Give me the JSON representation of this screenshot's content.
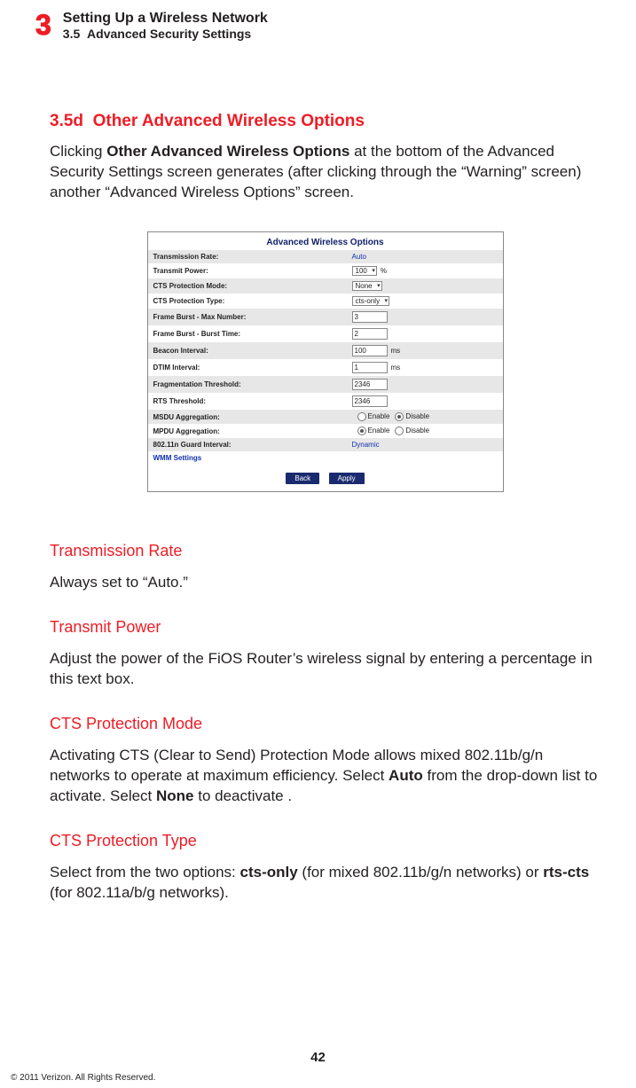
{
  "header": {
    "chapter_number": "3",
    "chapter_title": "Setting Up a Wireless Network",
    "section_number": "3.5",
    "section_title": "Advanced Security Settings"
  },
  "section_heading": {
    "number": "3.5d",
    "title": "Other Advanced Wireless Options"
  },
  "intro": {
    "pre": "Clicking ",
    "bold": "Other Advanced Wireless Options",
    "post": " at the bottom of the Advanced Security Settings screen generates (after clicking through the “Warning” screen) another “Advanced Wireless Options” screen."
  },
  "screenshot": {
    "panel_title": "Advanced Wireless Options",
    "rows": [
      {
        "label": "Transmission Rate:",
        "value": "Auto",
        "kind": "text"
      },
      {
        "label": "Transmit Power:",
        "value": "100",
        "unit": "%",
        "kind": "select"
      },
      {
        "label": "CTS Protection Mode:",
        "value": "None",
        "kind": "select"
      },
      {
        "label": "CTS Protection Type:",
        "value": "cts-only",
        "kind": "select"
      },
      {
        "label": "Frame Burst - Max Number:",
        "value": "3",
        "kind": "input"
      },
      {
        "label": "Frame Burst - Burst Time:",
        "value": "2",
        "kind": "input"
      },
      {
        "label": "Beacon Interval:",
        "value": "100",
        "unit": "ms",
        "kind": "input"
      },
      {
        "label": "DTIM Interval:",
        "value": "1",
        "unit": "ms",
        "kind": "input"
      },
      {
        "label": "Fragmentation Threshold:",
        "value": "2346",
        "kind": "input"
      },
      {
        "label": "RTS Threshold:",
        "value": "2346",
        "kind": "input"
      },
      {
        "label": "MSDU Aggregation:",
        "enable": "Enable",
        "disable": "Disable",
        "selected": "disable",
        "kind": "radio"
      },
      {
        "label": "MPDU Aggregation:",
        "enable": "Enable",
        "disable": "Disable",
        "selected": "enable",
        "kind": "radio"
      },
      {
        "label": "802.11n Guard Interval:",
        "value": "Dynamic",
        "kind": "text"
      }
    ],
    "link_row": "WMM Settings",
    "back_button": "Back",
    "apply_button": "Apply"
  },
  "subsections": [
    {
      "title": "Transmission Rate",
      "body_plain": "Always set to “Auto.”"
    },
    {
      "title": "Transmit Power",
      "body_plain": "Adjust the power of the FiOS Router’s wireless signal by entering a percentage in this text box."
    },
    {
      "title": "CTS Protection Mode",
      "body_parts": [
        "Activating CTS (Clear to Send) Protection Mode allows mixed 802.11b/g/n networks to operate at maximum efficiency. Select ",
        "Auto",
        " from the drop-down list to activate. Select ",
        "None",
        " to deactivate ."
      ]
    },
    {
      "title": "CTS Protection Type",
      "body_parts": [
        "Select from the two options: ",
        "cts-only",
        " (for mixed 802.11b/g/n networks) or ",
        "rts-cts",
        " (for 802.11a/b/g networks)."
      ]
    }
  ],
  "page_number": "42",
  "copyright": "© 2011 Verizon. All Rights Reserved."
}
